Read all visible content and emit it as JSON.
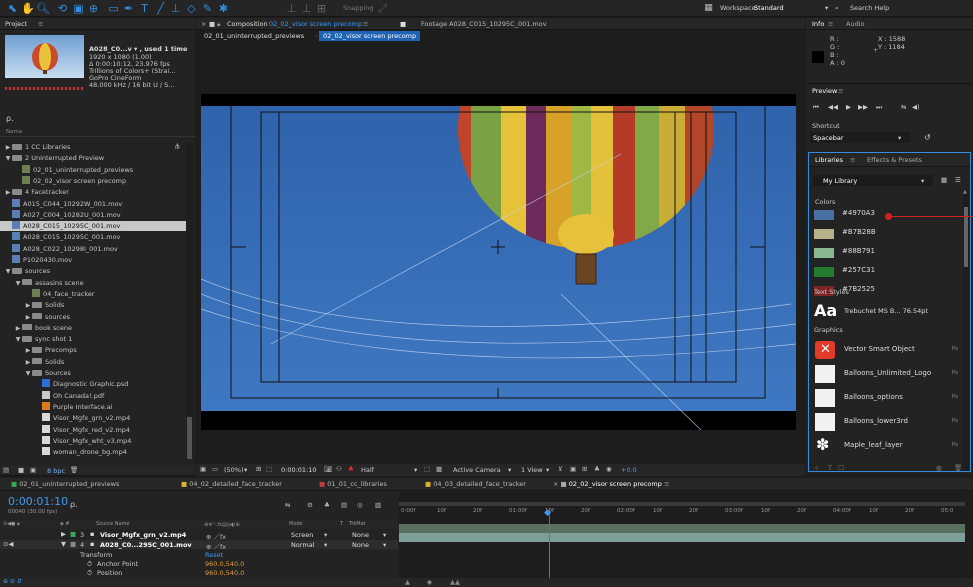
{
  "toolbar": {
    "snapping": "Snapping",
    "workspace_label": "Workspace:",
    "workspace_value": "Standard",
    "search_help": "Search Help"
  },
  "project": {
    "title": "Project",
    "item_name": "A028_C0...v ▾ , used 1 time",
    "item_meta": [
      "1920 x 1080 (1.00)",
      "Δ 0:00:10:12, 23.976 fps",
      "Trillions of Colors+ (Strai...",
      "GoPro CineForm",
      "48.000 kHz / 16 bit U / S..."
    ],
    "search_placeholder": "ρ.",
    "column_name": "Name",
    "bpc": "8 bpc",
    "tree": [
      {
        "label": "1 CC Libraries",
        "indent": 0,
        "type": "folder",
        "tw": "▶"
      },
      {
        "label": "2 Uninterrupted Preview",
        "indent": 0,
        "type": "folder",
        "tw": "▼"
      },
      {
        "label": "02_01_uninterrupted_previews",
        "indent": 1,
        "type": "comp",
        "tw": ""
      },
      {
        "label": "02_02_visor screen precomp",
        "indent": 1,
        "type": "comp",
        "tw": ""
      },
      {
        "label": "4 Facetracker",
        "indent": 0,
        "type": "folder",
        "tw": "▶"
      },
      {
        "label": "A015_C044_10292W_001.mov",
        "indent": 0,
        "type": "mov",
        "tw": ""
      },
      {
        "label": "A027_C004_10282U_001.mov",
        "indent": 0,
        "type": "mov",
        "tw": ""
      },
      {
        "label": "A028_C015_10295C_001.mov",
        "indent": 0,
        "type": "mov",
        "tw": "",
        "selected": true
      },
      {
        "label": "A028_C015_10295C_001.mov",
        "indent": 0,
        "type": "mov",
        "tw": ""
      },
      {
        "label": "A028_C022_10298I_001.mov",
        "indent": 0,
        "type": "mov",
        "tw": ""
      },
      {
        "label": "P1020430.mov",
        "indent": 0,
        "type": "mov",
        "tw": ""
      },
      {
        "label": "sources",
        "indent": 0,
        "type": "folder",
        "tw": "▼"
      },
      {
        "label": "assasins scene",
        "indent": 1,
        "type": "folder",
        "tw": "▼"
      },
      {
        "label": "04_face_tracker",
        "indent": 2,
        "type": "comp",
        "tw": ""
      },
      {
        "label": "Solids",
        "indent": 2,
        "type": "folder",
        "tw": "▶"
      },
      {
        "label": "sources",
        "indent": 2,
        "type": "folder",
        "tw": "▶"
      },
      {
        "label": "book scene",
        "indent": 1,
        "type": "folder",
        "tw": "▶"
      },
      {
        "label": "sync shot 1",
        "indent": 1,
        "type": "folder",
        "tw": "▼"
      },
      {
        "label": "Precomps",
        "indent": 2,
        "type": "folder",
        "tw": "▶"
      },
      {
        "label": "Solids",
        "indent": 2,
        "type": "folder",
        "tw": "▶"
      },
      {
        "label": "Sources",
        "indent": 2,
        "type": "folder",
        "tw": "▼"
      },
      {
        "label": "Diagnostic Graphic.psd",
        "indent": 3,
        "type": "psd",
        "tw": ""
      },
      {
        "label": "Oh Canada!.pdf",
        "indent": 3,
        "type": "pdf",
        "tw": ""
      },
      {
        "label": "Purple Interface.ai",
        "indent": 3,
        "type": "ai",
        "tw": ""
      },
      {
        "label": "Visor_Mgfx_grn_v2.mp4",
        "indent": 3,
        "type": "file",
        "tw": ""
      },
      {
        "label": "Visor_Mgfx_red_v2.mp4",
        "indent": 3,
        "type": "file",
        "tw": ""
      },
      {
        "label": "Visor_Mgfx_wht_v3.mp4",
        "indent": 3,
        "type": "file",
        "tw": ""
      },
      {
        "label": "woman_drone_bg.mp4",
        "indent": 3,
        "type": "file",
        "tw": ""
      }
    ]
  },
  "composition": {
    "tab_label": "Composition",
    "tab_name": "02_02_visor screen precomp",
    "footage_tab": "Footage A028_C015_10295C_001.mov",
    "breadcrumb_1": "02_01_uninterrupted_previews",
    "breadcrumb_2": "02_02_visor screen precomp",
    "zoom": "(50%)",
    "timecode": "0:00:01:10",
    "resolution": "Half",
    "camera": "Active Camera",
    "view": "1 View",
    "exposure": "+0.0"
  },
  "info": {
    "tab_info": "Info",
    "tab_audio": "Audio",
    "r": "R :",
    "g": "G :",
    "b": "B :",
    "a": "A : 0",
    "x": "X : 1588",
    "y": "Y : 1184"
  },
  "preview": {
    "title": "Preview",
    "shortcut_label": "Shortcut",
    "shortcut_value": "Spacebar"
  },
  "libraries": {
    "tab": "Libraries",
    "tab2": "Effects & Presets",
    "dropdown": "My Library",
    "colors_heading": "Colors",
    "colors": [
      {
        "hex": "#4970A3",
        "label": "#4970A3"
      },
      {
        "hex": "#B7B28B",
        "label": "#B7B28B"
      },
      {
        "hex": "#88B791",
        "label": "#88B791"
      },
      {
        "hex": "#257C31",
        "label": "#257C31"
      },
      {
        "hex": "#7B2525",
        "label": "#7B2525"
      }
    ],
    "text_styles_heading": "Text Styles",
    "text_style": "Trebuchet MS B...  76.54pt",
    "graphics_heading": "Graphics",
    "graphics": [
      {
        "label": "Vector Smart Object",
        "badge": "Ps"
      },
      {
        "label": "Balloons_Unlimited_Logo",
        "badge": "Ps"
      },
      {
        "label": "Balloons_options",
        "badge": "Ps"
      },
      {
        "label": "Balloons_lower3rd",
        "badge": "Ps"
      },
      {
        "label": "Maple_leaf_layer",
        "badge": "Ps"
      }
    ]
  },
  "timeline": {
    "tabs": [
      {
        "label": "02_01_uninterrupted_previews",
        "color": "#3aa655"
      },
      {
        "label": "04_02_detailed_face_tracker",
        "color": "#d6b42a"
      },
      {
        "label": "01_01_cc_libraries",
        "color": "#c23b3b"
      },
      {
        "label": "04_03_detailed_face_tracker",
        "color": "#d6b42a"
      },
      {
        "label": "02_02_visor screen precomp",
        "color": "#aaaaaa",
        "active": true
      }
    ],
    "timecode": "0:00:01:10",
    "fps": "00040 (30.00 fps)",
    "col_source": "Source Name",
    "col_mode": "Mode",
    "col_t": "T",
    "col_trkmat": "TrkMat",
    "layers": [
      {
        "num": "3",
        "name": "Visor_Mgfx_grn_v2.mp4",
        "mode": "Screen",
        "trk": "None"
      },
      {
        "num": "4",
        "name": "A028_C0...295C_001.mov",
        "mode": "Normal",
        "trk": "None"
      }
    ],
    "transform": "Transform",
    "reset": "Reset",
    "anchor": "Anchor Point",
    "anchor_val": "960.0,540.0",
    "position": "Position",
    "position_val": "960.0,540.0",
    "ruler": [
      "0:00f",
      "10f",
      "20f",
      "01:00f",
      "10f",
      "20f",
      "02:00f",
      "10f",
      "20f",
      "03:00f",
      "10f",
      "20f",
      "04:00f",
      "10f",
      "20f",
      "05:0"
    ]
  }
}
